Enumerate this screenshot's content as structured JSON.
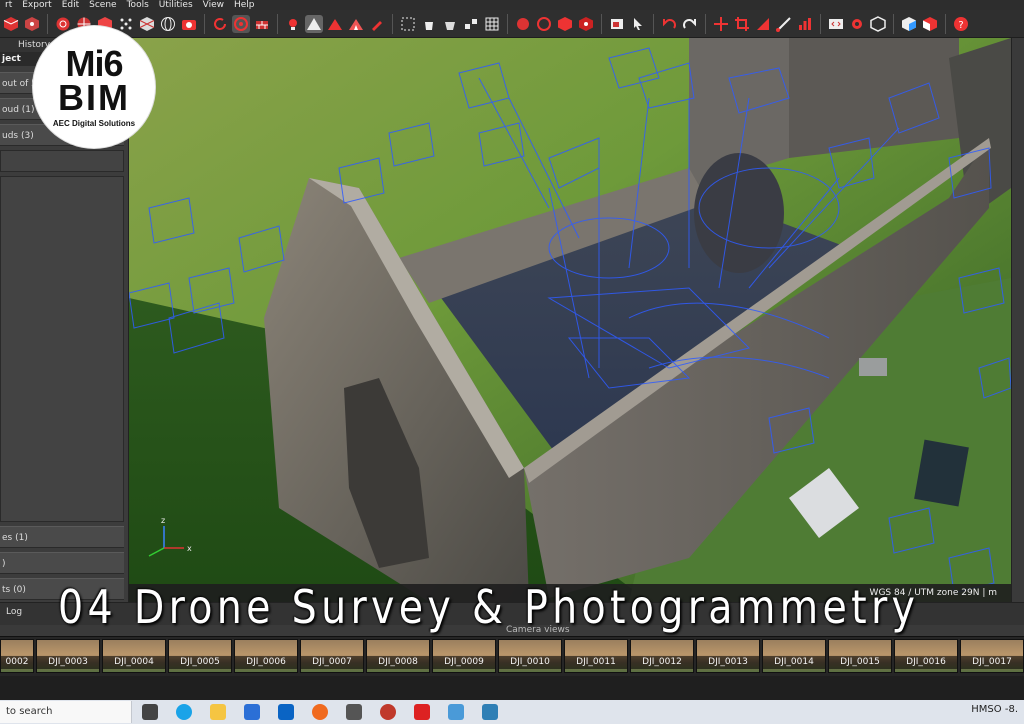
{
  "menu": [
    "rt",
    "Export",
    "Edit",
    "Scene",
    "Tools",
    "Utilities",
    "View",
    "Help"
  ],
  "left_panel": {
    "tabs": [
      "",
      "History"
    ],
    "header": "ject",
    "rows": [
      "out of 5",
      "oud (1)",
      "uds (3)"
    ],
    "lower_rows": [
      "es (1)",
      ")",
      "ts (0)"
    ]
  },
  "logo": {
    "line1": "Mi6",
    "line2": "BIM",
    "line3": "AEC Digital Solutions"
  },
  "status": {
    "coords": "WGS 84 / UTM zone 29N",
    "unit": "m"
  },
  "log_tab": "Log",
  "camera_label": "Camera views",
  "headline": "04 Drone Survey & Photogrammetry",
  "filmstrip": [
    "0002",
    "DJI_0003",
    "DJI_0004",
    "DJI_0005",
    "DJI_0006",
    "DJI_0007",
    "DJI_0008",
    "DJI_0009",
    "DJI_0010",
    "DJI_0011",
    "DJI_0012",
    "DJI_0013",
    "DJI_0014",
    "DJI_0015",
    "DJI_0016",
    "DJI_0017"
  ],
  "taskbar": {
    "search_placeholder": "to search",
    "app_label": "HMSO",
    "temp": "-8."
  },
  "axis_labels": {
    "z": "z",
    "x": "x"
  },
  "colors": {
    "accent": "#3a82ff",
    "frustum": "#2f5cff",
    "toolbar_red": "#e23b3b"
  }
}
